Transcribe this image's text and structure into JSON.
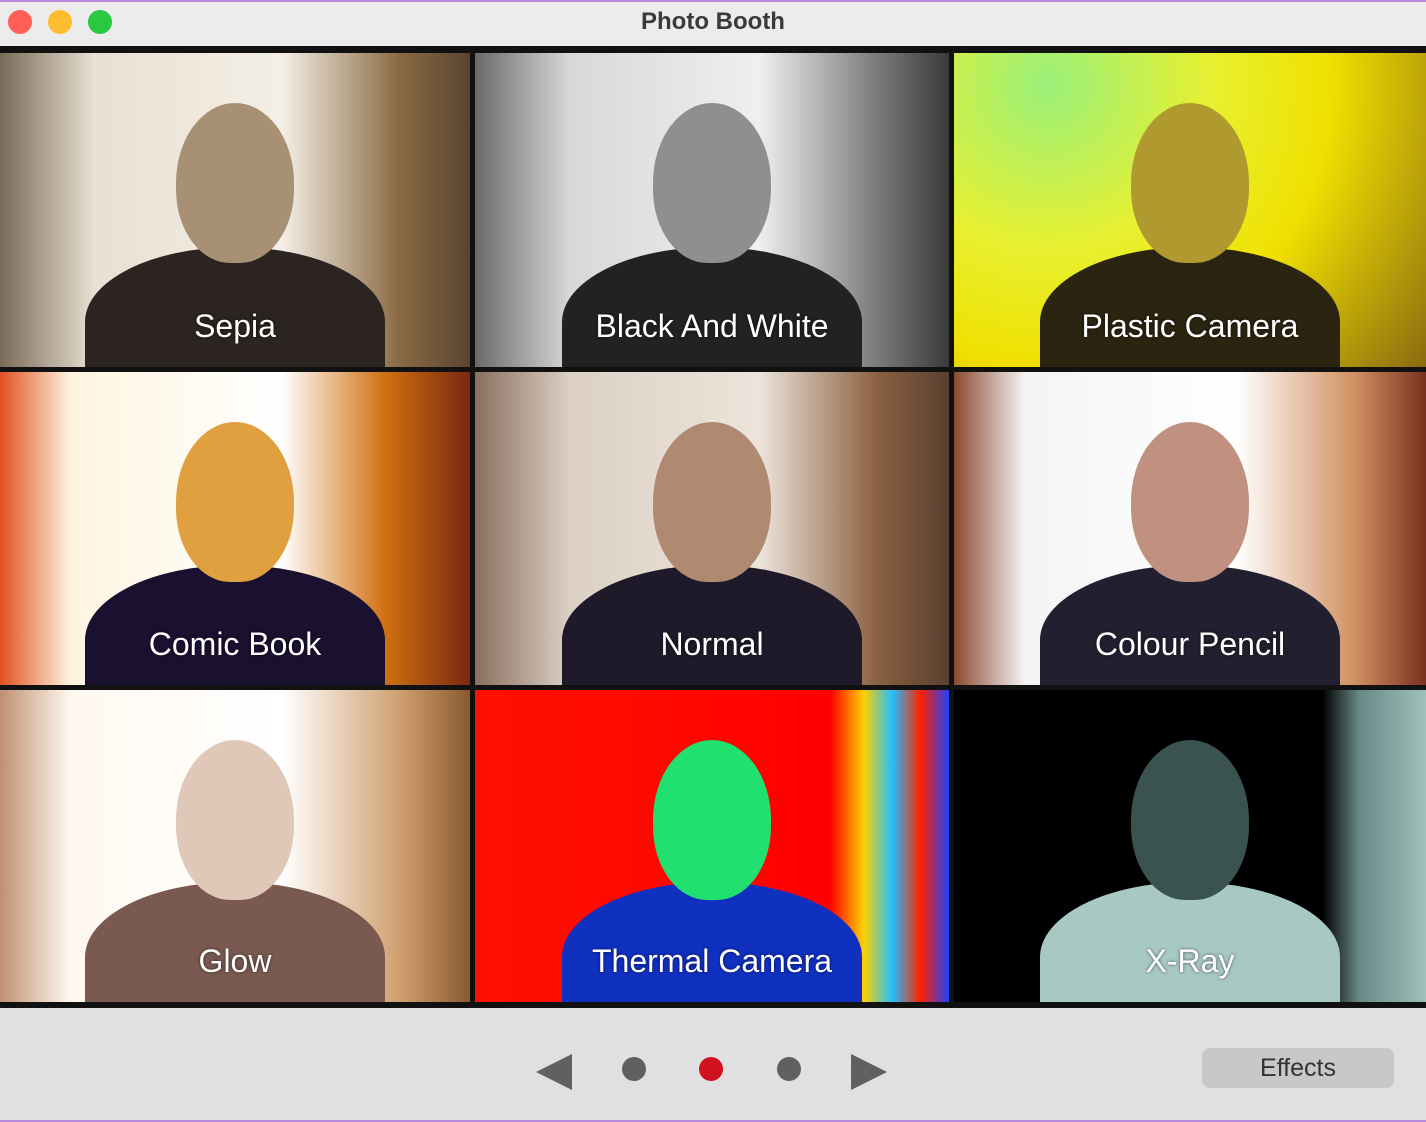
{
  "window": {
    "title": "Photo Booth"
  },
  "traffic_lights": {
    "close": "#ff5f57",
    "minimize": "#febc2e",
    "zoom": "#28c840"
  },
  "effects_grid": [
    {
      "label": "Sepia",
      "bg": "linear-gradient(90deg,#7a6a58 0%,#e8e0d2 20%,#f4efe6 60%,#8a6a44 85%,#5a4430 100%)",
      "face": "#a89074",
      "body": "#2b2420"
    },
    {
      "label": "Black And White",
      "bg": "linear-gradient(90deg,#6a6a6a 0%,#d8d8d8 20%,#efefef 60%,#7a7a7a 85%,#3a3a3a 100%)",
      "face": "#8f8f8f",
      "body": "#222"
    },
    {
      "label": "Plastic Camera",
      "bg": "radial-gradient(circle at 20% 10%,#9af07a 0%,#e8f030 35%,#f0e000 60%,#8a6a10 100%)",
      "face": "#b09a30",
      "body": "#2a2410"
    },
    {
      "label": "Comic Book",
      "bg": "linear-gradient(90deg,#e05020 0%,#fff4e0 15%,#ffffff 60%,#d07010 82%,#7a2810 100%)",
      "face": "#e0a040",
      "body": "#1a1030"
    },
    {
      "label": "Normal",
      "bg": "linear-gradient(90deg,#8a7060 0%,#dcd0c4 20%,#ece4da 60%,#8a6040 85%,#5a4030 100%)",
      "face": "#b08a70",
      "body": "#1e1a2a"
    },
    {
      "label": "Colour Pencil",
      "bg": "linear-gradient(90deg,#8a4a30 0%,#f4f4f4 15%,#ffffff 60%,#d09060 85%,#7a3020 100%)",
      "face": "#c09080",
      "body": "#222030"
    },
    {
      "label": "Glow",
      "bg": "linear-gradient(90deg,#c09070 0%,#fff8f0 15%,#ffffff 60%,#d0a070 85%,#8a5a30 100%)",
      "face": "#e0c8b8",
      "body": "#7a5a50"
    },
    {
      "label": "Thermal Camera",
      "bg": "linear-gradient(90deg,#ff1000 0%,#ff0000 75%,#ffd000 82%,#20c0ff 88%,#ff2000 94%,#2040ff 100%)",
      "face": "#20e070",
      "body": "#1030c0"
    },
    {
      "label": "X-Ray",
      "bg": "linear-gradient(90deg,#000 0%,#000 78%,#6a8a88 86%,#a0c0bc 100%)",
      "face": "#3a5250",
      "body": "#a8c8c4"
    }
  ],
  "controls": {
    "prev_icon": "triangle-left-icon",
    "next_icon": "triangle-right-icon",
    "pages": [
      {
        "active": false
      },
      {
        "active": true
      },
      {
        "active": false
      }
    ],
    "active_color": "#d0101e",
    "inactive_color": "#606060",
    "effects_label": "Effects"
  }
}
